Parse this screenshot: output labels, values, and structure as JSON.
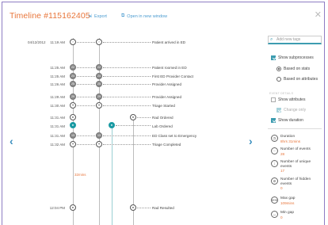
{
  "header": {
    "title": "Timeline #115162405",
    "export_label": "Export",
    "open_window_label": "Open in new window"
  },
  "timeline": {
    "date": "04/12/2012",
    "rows": [
      {
        "time": "11:19 AM",
        "badge": "",
        "label": "Patient arrived in ED"
      },
      {
        "time": "11:25 AM",
        "badge": "22",
        "label": "Patient roomed in ED"
      },
      {
        "time": "11:25 AM",
        "badge": "24",
        "label": "First ED Provider Contact"
      },
      {
        "time": "11:26 AM",
        "badge": "25",
        "label": "Provider Assigned"
      },
      {
        "time": "11:29 AM",
        "badge": "29",
        "label": "Provider Assigned"
      },
      {
        "time": "11:30 AM",
        "badge": "",
        "label": "Triage Started"
      },
      {
        "time": "11:31 AM",
        "badge": "",
        "label": "Rad Ordered"
      },
      {
        "time": "11:31 AM",
        "badge": "",
        "label": "Lab Ordered"
      },
      {
        "time": "11:31 AM",
        "badge": "13",
        "label": "ED Class set to Emergency"
      },
      {
        "time": "11:32 AM",
        "badge": "",
        "label": "Triage Completed"
      },
      {
        "time": "12:04 PM",
        "badge": "",
        "label": "Rad Resulted"
      }
    ],
    "gap_label": "32mins"
  },
  "sidebar": {
    "search_placeholder": "Add new tags",
    "show_subprocesses": "Show subprocesses",
    "based_on_stats": "Based on stats",
    "based_on_attributes": "Based on attributes",
    "section_label": "EVENT DETAILS",
    "show_attributes": "Show attributes",
    "change_only": "Change only",
    "show_duration": "Show duration",
    "stats": [
      {
        "icon": "clock-icon",
        "label": "Duration",
        "value": "8hrs 31mins"
      },
      {
        "icon": "events-icon",
        "label": "Number of events",
        "value": "28"
      },
      {
        "icon": "unique-events-icon",
        "label": "Number of unique events",
        "value": "17"
      },
      {
        "icon": "hidden-events-icon",
        "label": "Number of hidden events",
        "value": "0"
      },
      {
        "icon": "max-gap-icon",
        "label": "Max gap",
        "value": "109mins"
      },
      {
        "icon": "min-gap-icon",
        "label": "Min gap",
        "value": "0"
      }
    ]
  },
  "colors": {
    "accent": "#e8753a",
    "link": "#4a9bd0",
    "teal": "#1a9aa3"
  }
}
